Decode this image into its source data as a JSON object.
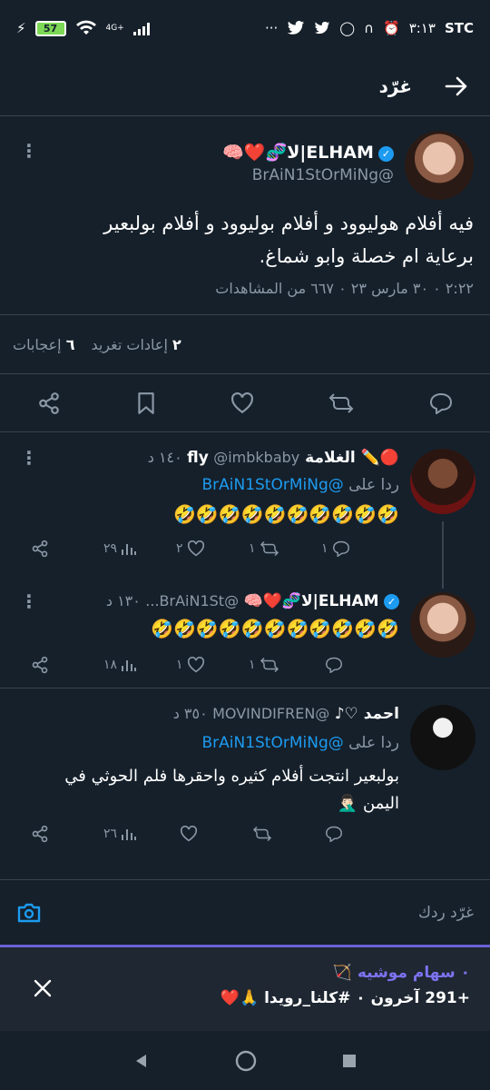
{
  "status_bar": {
    "battery": "57",
    "network": "4G+",
    "time": "٣:١٣",
    "carrier": "STC"
  },
  "header": {
    "title": "غرّد"
  },
  "main_tweet": {
    "name": "ELHAM|لا🧬❤️🧠",
    "handle": "@BrAiN1StOrMiNg",
    "text_line1": "فيه أفلام هوليوود و أفلام بوليوود و أفلام بولبعير",
    "text_line2": "برعاية ام خصلة وابو شماغ.",
    "meta": "٢:٢٢ ٠ ٣٠ مارس ٢٣ ٠ ٦٦٧ من المشاهدات",
    "retweets_count": "٢",
    "retweets_label": "إعادات تغريد",
    "likes_count": "٦",
    "likes_label": "إعجابات"
  },
  "replies": [
    {
      "name": "🔴✏️ الغلامة fly",
      "handle": "@imbkbaby",
      "time": "١٤٠ د",
      "reply_to_label": "ردا على",
      "reply_to": "@BrAiN1StOrMiNg",
      "text": "🤣🤣🤣🤣🤣🤣🤣🤣🤣🤣",
      "reply_count": "١",
      "retweet_count": "١",
      "like_count": "٢",
      "views_count": "٢٩"
    },
    {
      "name": "ELHAM|لا🧬❤️🧠",
      "handle": "@BrAiN1St...",
      "time": "١٣٠ د",
      "text": "🤣🤣🤣🤣🤣🤣🤣🤣🤣🤣🤣",
      "reply_count": "",
      "retweet_count": "١",
      "like_count": "١",
      "views_count": "١٨"
    },
    {
      "name": "احمد ♡♪",
      "handle": "@MOVINDIFREN",
      "time": "٣٥٠ د",
      "reply_to_label": "ردا على",
      "reply_to": "@BrAiN1StOrMiNg",
      "text_line1": "بولبعير انتجت أفلام كثيره واحقرها فلم الحوثي في",
      "text_line2": "اليمن 🤦🏻‍♂️",
      "reply_count": "",
      "retweet_count": "",
      "like_count": "",
      "views_count": "٢٦"
    }
  ],
  "compose": {
    "placeholder": "غرّد ردك"
  },
  "spaces": {
    "host": "سهام موشيه 🏹",
    "host_prefix": "٠",
    "listeners": "+291 آخرون ٠ #كلنا_رويدا 🙏❤️"
  },
  "colors": {
    "background": "#15202b",
    "accent": "#1d9bf0",
    "muted": "#8b98a5",
    "spaces": "#6b62d6"
  }
}
